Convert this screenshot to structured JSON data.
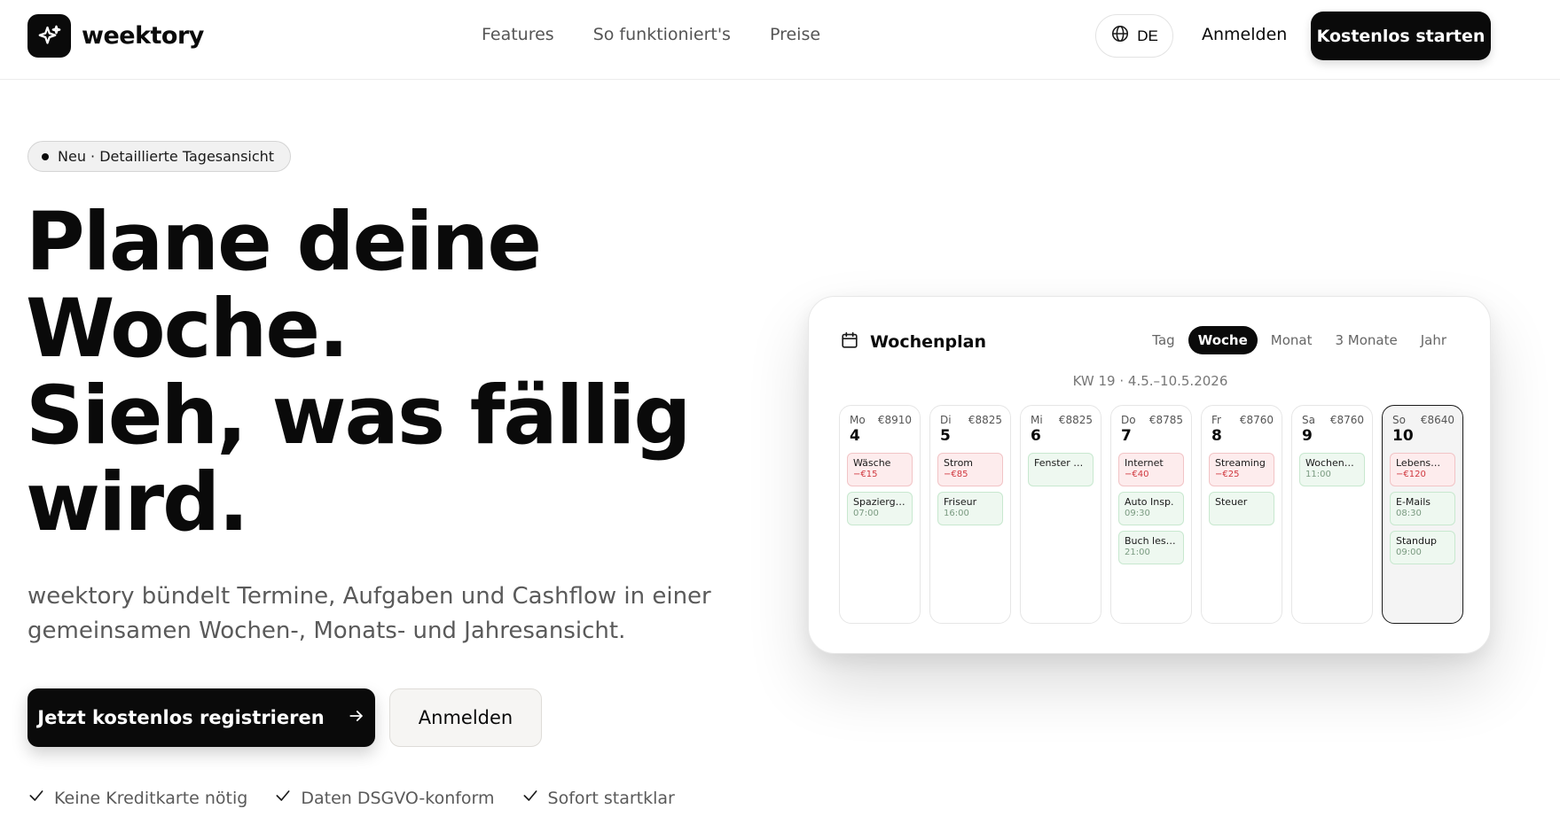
{
  "header": {
    "brand": "weektory",
    "nav": [
      "Features",
      "So funktioniert's",
      "Preise"
    ],
    "language": "DE",
    "login": "Anmelden",
    "cta": "Kostenlos starten"
  },
  "hero": {
    "badge": "Neu · Detaillierte Tagesansicht",
    "title_lines": [
      "Plane deine",
      "Woche.",
      "Sieh, was fällig",
      "wird."
    ],
    "subtitle": "weektory bündelt Termine, Aufgaben und Cashflow in einer gemeinsamen Wochen-, Monats- und Jahresansicht.",
    "primary_button": "Jetzt kostenlos registrieren",
    "secondary_button": "Anmelden",
    "checks": [
      "Keine Kreditkarte nötig",
      "Daten DSGVO-konform",
      "Sofort startklar"
    ]
  },
  "calendar": {
    "title": "Wochenplan",
    "views": [
      "Tag",
      "Woche",
      "Monat",
      "3 Monate",
      "Jahr"
    ],
    "active_view": "Woche",
    "week_label": "KW 19 · 4.5.–10.5.2026",
    "days": [
      {
        "abbr": "Mo",
        "num": "4",
        "balance": "€8910",
        "today": false,
        "events": [
          {
            "name": "Wäsche",
            "sub": "−€15",
            "kind": "expense"
          },
          {
            "name": "Spazierga…",
            "sub": "07:00",
            "kind": "appointment"
          }
        ]
      },
      {
        "abbr": "Di",
        "num": "5",
        "balance": "€8825",
        "today": false,
        "events": [
          {
            "name": "Strom",
            "sub": "−€85",
            "kind": "expense"
          },
          {
            "name": "Friseur",
            "sub": "16:00",
            "kind": "appointment"
          }
        ]
      },
      {
        "abbr": "Mi",
        "num": "6",
        "balance": "€8825",
        "today": false,
        "events": [
          {
            "name": "Fenster p…",
            "sub": "",
            "kind": "appointment"
          }
        ]
      },
      {
        "abbr": "Do",
        "num": "7",
        "balance": "€8785",
        "today": false,
        "events": [
          {
            "name": "Internet",
            "sub": "−€40",
            "kind": "expense"
          },
          {
            "name": "Auto Insp.",
            "sub": "09:30",
            "kind": "appointment"
          },
          {
            "name": "Buch lesen",
            "sub": "21:00",
            "kind": "appointment"
          }
        ]
      },
      {
        "abbr": "Fr",
        "num": "8",
        "balance": "€8760",
        "today": false,
        "events": [
          {
            "name": "Streaming",
            "sub": "−€25",
            "kind": "expense"
          },
          {
            "name": "Steuer",
            "sub": "",
            "kind": "appointment"
          }
        ]
      },
      {
        "abbr": "Sa",
        "num": "9",
        "balance": "€8760",
        "today": false,
        "events": [
          {
            "name": "Wochenei…",
            "sub": "11:00",
            "kind": "appointment"
          }
        ]
      },
      {
        "abbr": "So",
        "num": "10",
        "balance": "€8640",
        "today": true,
        "events": [
          {
            "name": "Lebensmit…",
            "sub": "−€120",
            "kind": "expense"
          },
          {
            "name": "E-Mails",
            "sub": "08:30",
            "kind": "appointment"
          },
          {
            "name": "Standup",
            "sub": "09:00",
            "kind": "appointment"
          }
        ]
      }
    ]
  },
  "colors": {
    "accent": "#0a0a0a",
    "expense_bg": "#fdeced",
    "expense_text": "#d0383f",
    "appointment_bg": "#eef8f0"
  }
}
